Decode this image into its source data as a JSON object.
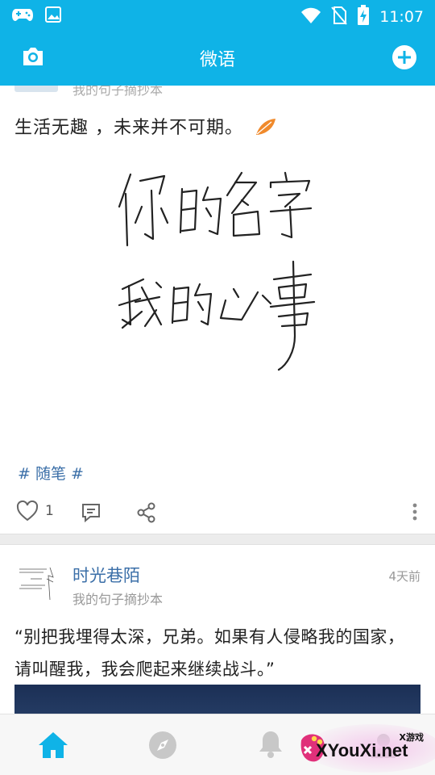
{
  "status_bar": {
    "time": "11:07",
    "icons": [
      "gamepad-icon",
      "image-icon",
      "wifi-icon",
      "no-sim-icon",
      "battery-charging-icon"
    ]
  },
  "header": {
    "title": "微语",
    "left_icon": "camera-icon",
    "right_icon": "add-circle-icon",
    "color": "#0fb3e7"
  },
  "feed": [
    {
      "source": "我的句子摘抄本",
      "text": "生活无趣 ，未来并不可期。",
      "image_lines": [
        "你的名字",
        "我的心事"
      ],
      "tag": "# 随笔 #",
      "likes": "1"
    },
    {
      "author": "时光巷陌",
      "time": "4天前",
      "source": "我的句子摘抄本",
      "text": "“别把我埋得太深，兄弟。如果有人侵略我的国家，请叫醒我，我会爬起来继续战斗。”"
    }
  ],
  "bottom_nav": {
    "items": [
      "home-icon",
      "compass-icon",
      "bell-icon",
      "profile-icon"
    ],
    "active": "home-icon"
  },
  "watermark": {
    "small": "X游戏",
    "big": "XYouXi.net"
  },
  "colors": {
    "accent": "#0fb3e7",
    "link": "#3b6fa8",
    "leaf": "#f08a2c"
  }
}
